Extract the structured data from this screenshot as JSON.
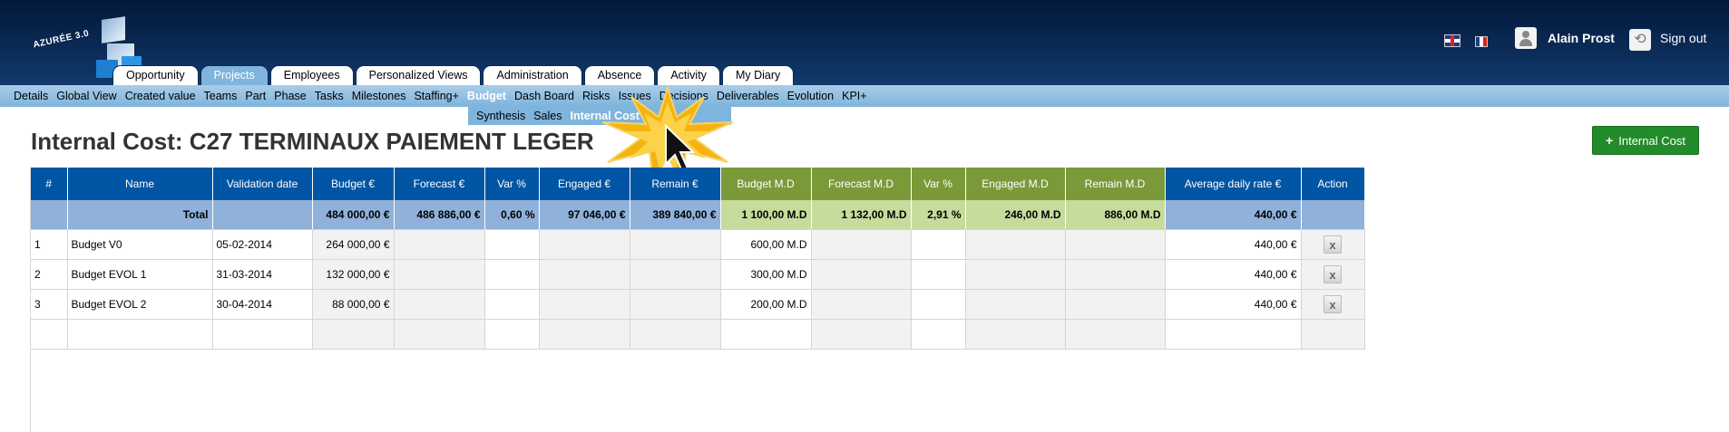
{
  "header": {
    "logo_text": "AZURÉE 3.0",
    "user_name": "Alain Prost",
    "sign_out": "Sign out",
    "flags": [
      "uk-flag",
      "fr-flag"
    ]
  },
  "main_tabs": [
    "Opportunity",
    "Projects",
    "Employees",
    "Personalized Views",
    "Administration",
    "Absence",
    "Activity",
    "My Diary"
  ],
  "active_main_tab": "Projects",
  "sub_nav": [
    "Details",
    "Global View",
    "Created value",
    "Teams",
    "Part",
    "Phase",
    "Tasks",
    "Milestones",
    "Staffing+",
    "Budget",
    "Dash Board",
    "Risks",
    "Issues",
    "Decisions",
    "Deliverables",
    "Evolution",
    "KPI+"
  ],
  "active_sub_nav": "Budget",
  "sub_nav2": [
    "Synthesis",
    "Sales",
    "Internal Cost"
  ],
  "active_sub_nav2": "Internal Cost",
  "page_title": "Internal Cost: C27 TERMINAUX PAIEMENT LEGER",
  "add_button": "Internal Cost",
  "table": {
    "columns": [
      "#",
      "Name",
      "Validation date",
      "Budget €",
      "Forecast €",
      "Var %",
      "Engaged €",
      "Remain €",
      "Budget M.D",
      "Forecast M.D",
      "Var %",
      "Engaged M.D",
      "Remain M.D",
      "Average daily rate €",
      "Action"
    ],
    "total": [
      "",
      "Total",
      "",
      "484 000,00 €",
      "486 886,00 €",
      "0,60 %",
      "97 046,00 €",
      "389 840,00 €",
      "1 100,00 M.D",
      "1 132,00 M.D",
      "2,91 %",
      "246,00 M.D",
      "886,00 M.D",
      "440,00 €",
      ""
    ],
    "rows": [
      [
        "1",
        "Budget V0",
        "05-02-2014",
        "264 000,00 €",
        "",
        "",
        "",
        "",
        "600,00 M.D",
        "",
        "",
        "",
        "",
        "440,00 €",
        "x"
      ],
      [
        "2",
        "Budget EVOL 1",
        "31-03-2014",
        "132 000,00 €",
        "",
        "",
        "",
        "",
        "300,00 M.D",
        "",
        "",
        "",
        "",
        "440,00 €",
        "x"
      ],
      [
        "3",
        "Budget EVOL 2",
        "30-04-2014",
        "88 000,00 €",
        "",
        "",
        "",
        "",
        "200,00 M.D",
        "",
        "",
        "",
        "",
        "440,00 €",
        "x"
      ]
    ]
  },
  "colors": {
    "header_bg": "#0a2a55",
    "grid_header": "#0055a4",
    "md_header": "#7a9a3a",
    "total_row": "#8fb1da",
    "total_md": "#c6dc9c",
    "add_button": "#238c2a"
  }
}
